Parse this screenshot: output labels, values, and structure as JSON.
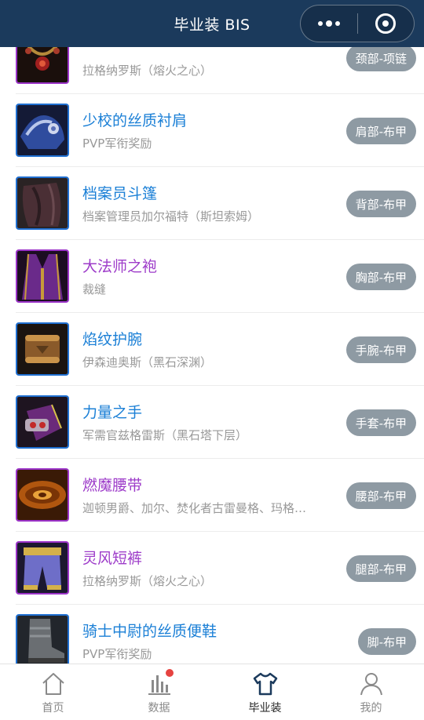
{
  "header": {
    "title": "毕业装 BIS"
  },
  "items": [
    {
      "name": "",
      "source": "拉格纳罗斯（熔火之心）",
      "slot": "颈部-项链",
      "quality": "purple",
      "icon": "necklace-icon"
    },
    {
      "name": "少校的丝质衬肩",
      "source": "PVP军衔奖励",
      "slot": "肩部-布甲",
      "quality": "blue",
      "icon": "shoulder-icon"
    },
    {
      "name": "档案员斗篷",
      "source": "档案管理员加尔福特（斯坦索姆）",
      "slot": "背部-布甲",
      "quality": "blue",
      "icon": "cloak-icon"
    },
    {
      "name": "大法师之袍",
      "source": "裁缝",
      "slot": "胸部-布甲",
      "quality": "purple",
      "icon": "robe-icon"
    },
    {
      "name": "焰纹护腕",
      "source": "伊森迪奥斯（黑石深渊）",
      "slot": "手腕-布甲",
      "quality": "blue",
      "icon": "bracer-icon"
    },
    {
      "name": "力量之手",
      "source": "军需官兹格雷斯（黑石塔下层）",
      "slot": "手套-布甲",
      "quality": "blue",
      "icon": "gloves-icon"
    },
    {
      "name": "燃魔腰带",
      "source": "迦顿男爵、加尔、焚化者古雷曼格、玛格…",
      "slot": "腰部-布甲",
      "quality": "purple",
      "icon": "belt-icon"
    },
    {
      "name": "灵风短裤",
      "source": "拉格纳罗斯（熔火之心）",
      "slot": "腿部-布甲",
      "quality": "purple",
      "icon": "pants-icon"
    },
    {
      "name": "骑士中尉的丝质便鞋",
      "source": "PVP军衔奖励",
      "slot": "脚-布甲",
      "quality": "blue",
      "icon": "boots-icon"
    }
  ],
  "tabs": [
    {
      "label": "首页",
      "icon": "home-icon"
    },
    {
      "label": "数据",
      "icon": "chart-icon"
    },
    {
      "label": "毕业装",
      "icon": "shirt-icon"
    },
    {
      "label": "我的",
      "icon": "user-icon"
    }
  ],
  "colors": {
    "header": "#1b3a5c",
    "blue_quality": "#1a7fd6",
    "purple_quality": "#9d3bc9",
    "badge": "#8e9aa3",
    "notify": "#e64340"
  }
}
